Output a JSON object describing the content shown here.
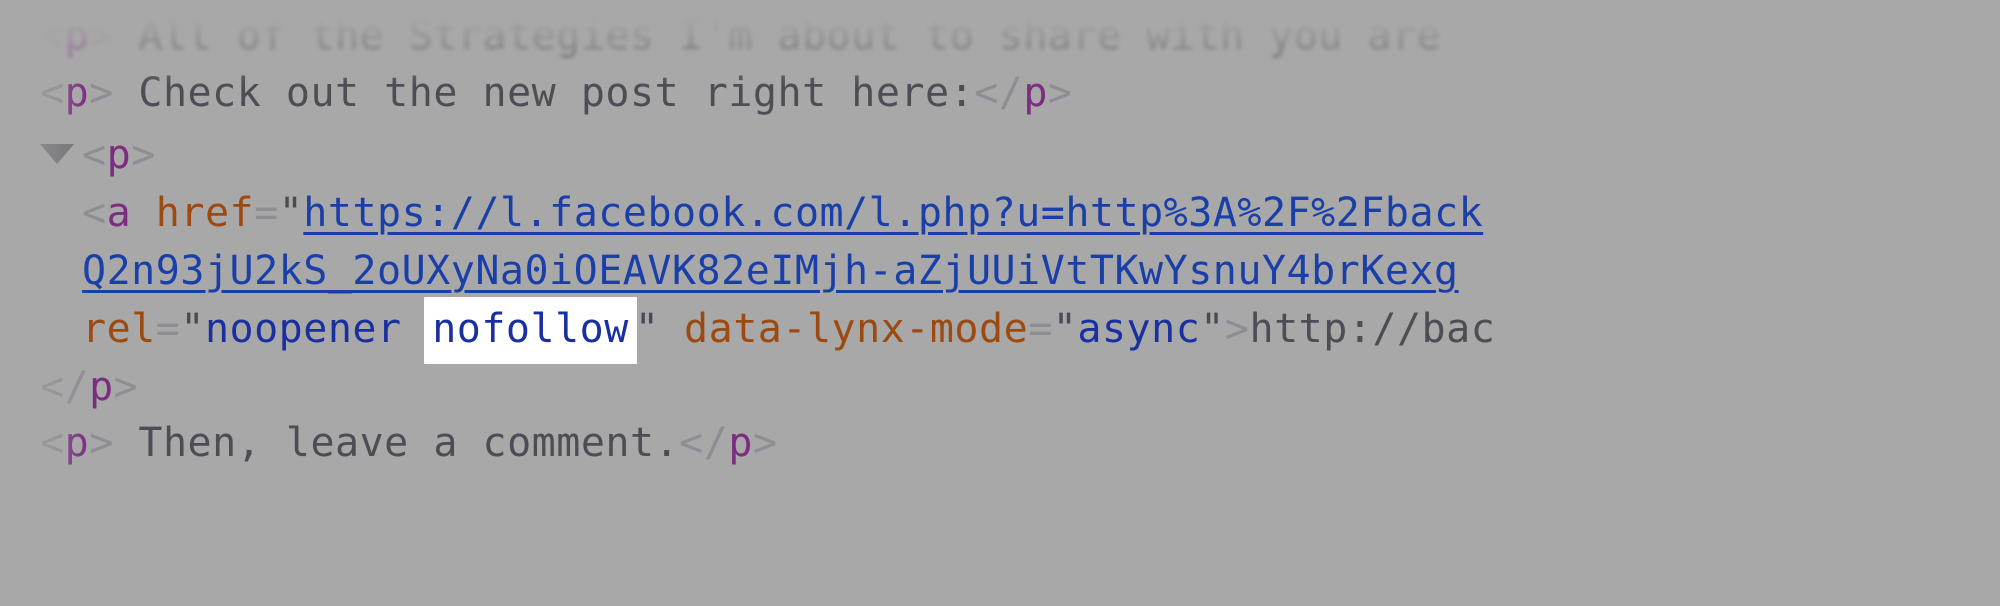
{
  "panel": {
    "name": "devtools-dom-tree",
    "background_color": "#a8a8a8",
    "font_size_px": 40
  },
  "colors": {
    "bracket": "#8d8d94",
    "tag_name": "#7c2d82",
    "attribute_name": "#9c4a12",
    "attribute_value": "#1a2fa0",
    "link": "#1a3fa8",
    "text_node": "#4d4d55",
    "highlight_background": "#ffffff"
  },
  "search_highlight": {
    "term": "nofollow",
    "active": true
  },
  "rows": [
    {
      "id": "row-0",
      "indent": 0,
      "faded": true,
      "tokens": [
        {
          "kind": "bracket",
          "text": "<"
        },
        {
          "kind": "tagname",
          "text": "p"
        },
        {
          "kind": "bracket",
          "text": ">"
        },
        {
          "kind": "text",
          "text": " All of the Strategies I'm about to share with you are"
        }
      ]
    },
    {
      "id": "row-1",
      "indent": 0,
      "faded": false,
      "tokens": [
        {
          "kind": "bracket",
          "text": "<"
        },
        {
          "kind": "tagname",
          "text": "p"
        },
        {
          "kind": "bracket",
          "text": ">"
        },
        {
          "kind": "text",
          "text": " Check out the new post right here:"
        },
        {
          "kind": "bracket",
          "text": "</"
        },
        {
          "kind": "tagname",
          "text": "p"
        },
        {
          "kind": "bracket",
          "text": ">"
        }
      ]
    },
    {
      "id": "row-2",
      "indent": 0,
      "twisty": true,
      "faded": false,
      "tokens": [
        {
          "kind": "bracket",
          "text": "<"
        },
        {
          "kind": "tagname",
          "text": "p"
        },
        {
          "kind": "bracket",
          "text": ">"
        }
      ]
    },
    {
      "id": "row-3",
      "indent": 1,
      "faded": false,
      "tokens": [
        {
          "kind": "bracket",
          "text": "<"
        },
        {
          "kind": "tagname",
          "text": "a"
        },
        {
          "kind": "plain",
          "text": " "
        },
        {
          "kind": "attrname",
          "text": "href"
        },
        {
          "kind": "equals",
          "text": "="
        },
        {
          "kind": "quote",
          "text": "\""
        },
        {
          "kind": "link",
          "text": "https://l.facebook.com/l.php?u=http%3A%2F%2Fback"
        }
      ]
    },
    {
      "id": "row-4",
      "indent": 1,
      "faded": false,
      "tokens": [
        {
          "kind": "link",
          "text": "Q2n93jU2kS_2oUXyNa0iOEAVK82eIMjh-aZjUUiVtTKwYsnuY4brKexg"
        }
      ]
    },
    {
      "id": "row-5",
      "indent": 1,
      "faded": false,
      "tokens": [
        {
          "kind": "attrname",
          "text": "rel"
        },
        {
          "kind": "equals",
          "text": "="
        },
        {
          "kind": "quote",
          "text": "\""
        },
        {
          "kind": "attrvalue",
          "text": "noopener "
        },
        {
          "kind": "highlight",
          "text": "nofollow"
        },
        {
          "kind": "quote",
          "text": "\""
        },
        {
          "kind": "plain",
          "text": " "
        },
        {
          "kind": "attrname",
          "text": "data-lynx-mode"
        },
        {
          "kind": "equals",
          "text": "="
        },
        {
          "kind": "quote",
          "text": "\""
        },
        {
          "kind": "attrvalue",
          "text": "async"
        },
        {
          "kind": "quote",
          "text": "\""
        },
        {
          "kind": "bracket",
          "text": ">"
        },
        {
          "kind": "text",
          "text": "http://bac"
        }
      ]
    },
    {
      "id": "row-6",
      "indent": 0,
      "faded": false,
      "tokens": [
        {
          "kind": "bracket",
          "text": "</"
        },
        {
          "kind": "tagname",
          "text": "p"
        },
        {
          "kind": "bracket",
          "text": ">"
        }
      ]
    },
    {
      "id": "row-7",
      "indent": 0,
      "faded": true,
      "tokens": [
        {
          "kind": "bracket",
          "text": "<"
        },
        {
          "kind": "tagname",
          "text": "p"
        },
        {
          "kind": "bracket",
          "text": ">"
        },
        {
          "kind": "text",
          "text": " Then, leave a comment."
        },
        {
          "kind": "bracket",
          "text": "</"
        },
        {
          "kind": "tagname",
          "text": "p"
        },
        {
          "kind": "bracket",
          "text": ">"
        }
      ]
    }
  ]
}
